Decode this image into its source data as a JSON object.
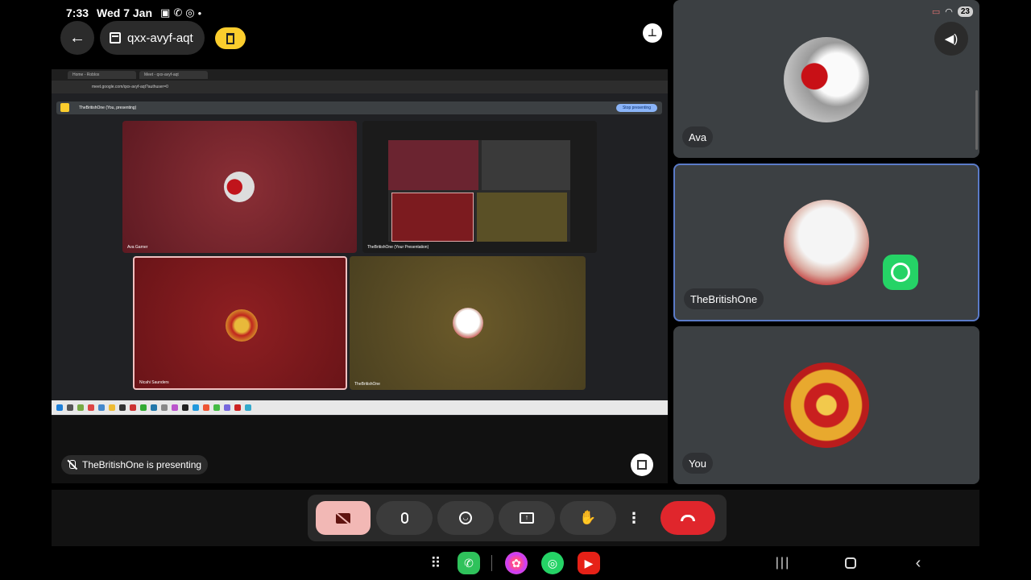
{
  "status": {
    "time": "7:33",
    "date": "Wed 7 Jan",
    "battery": "23"
  },
  "header": {
    "meeting_code": "qxx-avyf-aqt"
  },
  "shared_screen": {
    "tab_1": "Home - Roblox",
    "tab_2": "Meet - qxx-avyf-aqt",
    "url": "meet.google.com/qxx-avyf-aqt?authuser=0",
    "presenter_label": "TheBritishOne (You, presenting)",
    "stop_presenting": "Stop presenting",
    "tiles": {
      "ava_garner": "Ava Garner",
      "presentation": "TheBritishOne (Your Presentation)",
      "nicahi": "Nicahi Saunders",
      "british": "TheBritishOne"
    }
  },
  "presenting_notice": "TheBritishOne is presenting",
  "participants": [
    {
      "name": "Ava"
    },
    {
      "name": "TheBritishOne"
    },
    {
      "name": "You"
    }
  ],
  "colors": {
    "accent_yellow": "#fbcd2d",
    "end_call_red": "#e0262c",
    "camera_off_pink": "#f2b8b5",
    "tile_gray": "#3c4043",
    "active_border": "#5b7bc8"
  }
}
